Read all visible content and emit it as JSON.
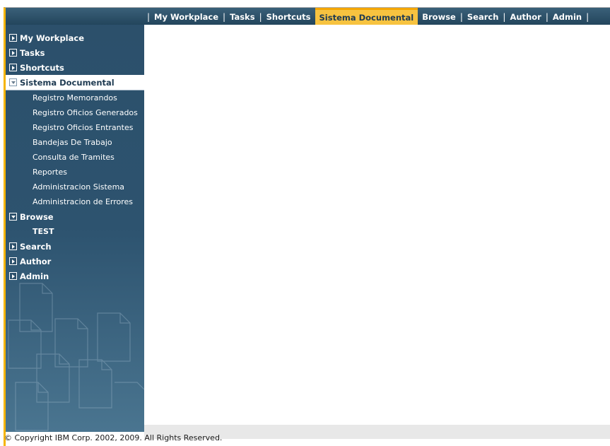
{
  "topnav": {
    "tabs": [
      {
        "label": "My Workplace"
      },
      {
        "label": "Tasks"
      },
      {
        "label": "Shortcuts"
      },
      {
        "label": "Sistema Documental"
      },
      {
        "label": "Browse"
      },
      {
        "label": "Search"
      },
      {
        "label": "Author"
      },
      {
        "label": "Admin"
      }
    ],
    "separator": "|"
  },
  "sidebar": {
    "items": [
      {
        "label": "My Workplace"
      },
      {
        "label": "Tasks"
      },
      {
        "label": "Shortcuts"
      },
      {
        "label": "Sistema Documental"
      },
      {
        "label": "Browse"
      },
      {
        "label": "Search"
      },
      {
        "label": "Author"
      },
      {
        "label": "Admin"
      }
    ],
    "sistema_children": [
      {
        "label": "Registro Memorandos"
      },
      {
        "label": "Registro Oficios Generados"
      },
      {
        "label": "Registro Oficios Entrantes"
      },
      {
        "label": "Bandejas De Trabajo"
      },
      {
        "label": "Consulta de Tramites"
      },
      {
        "label": "Reportes"
      },
      {
        "label": "Administracion Sistema"
      },
      {
        "label": "Administracion de Errores"
      }
    ],
    "browse_children": [
      {
        "label": "TEST"
      }
    ]
  },
  "footer": {
    "copyright": "© Copyright IBM Corp. 2002, 2009. All Rights Reserved."
  },
  "colors": {
    "nav_bg": "#2c506b",
    "accent": "#f7c340",
    "frame_border": "#f5b400"
  }
}
